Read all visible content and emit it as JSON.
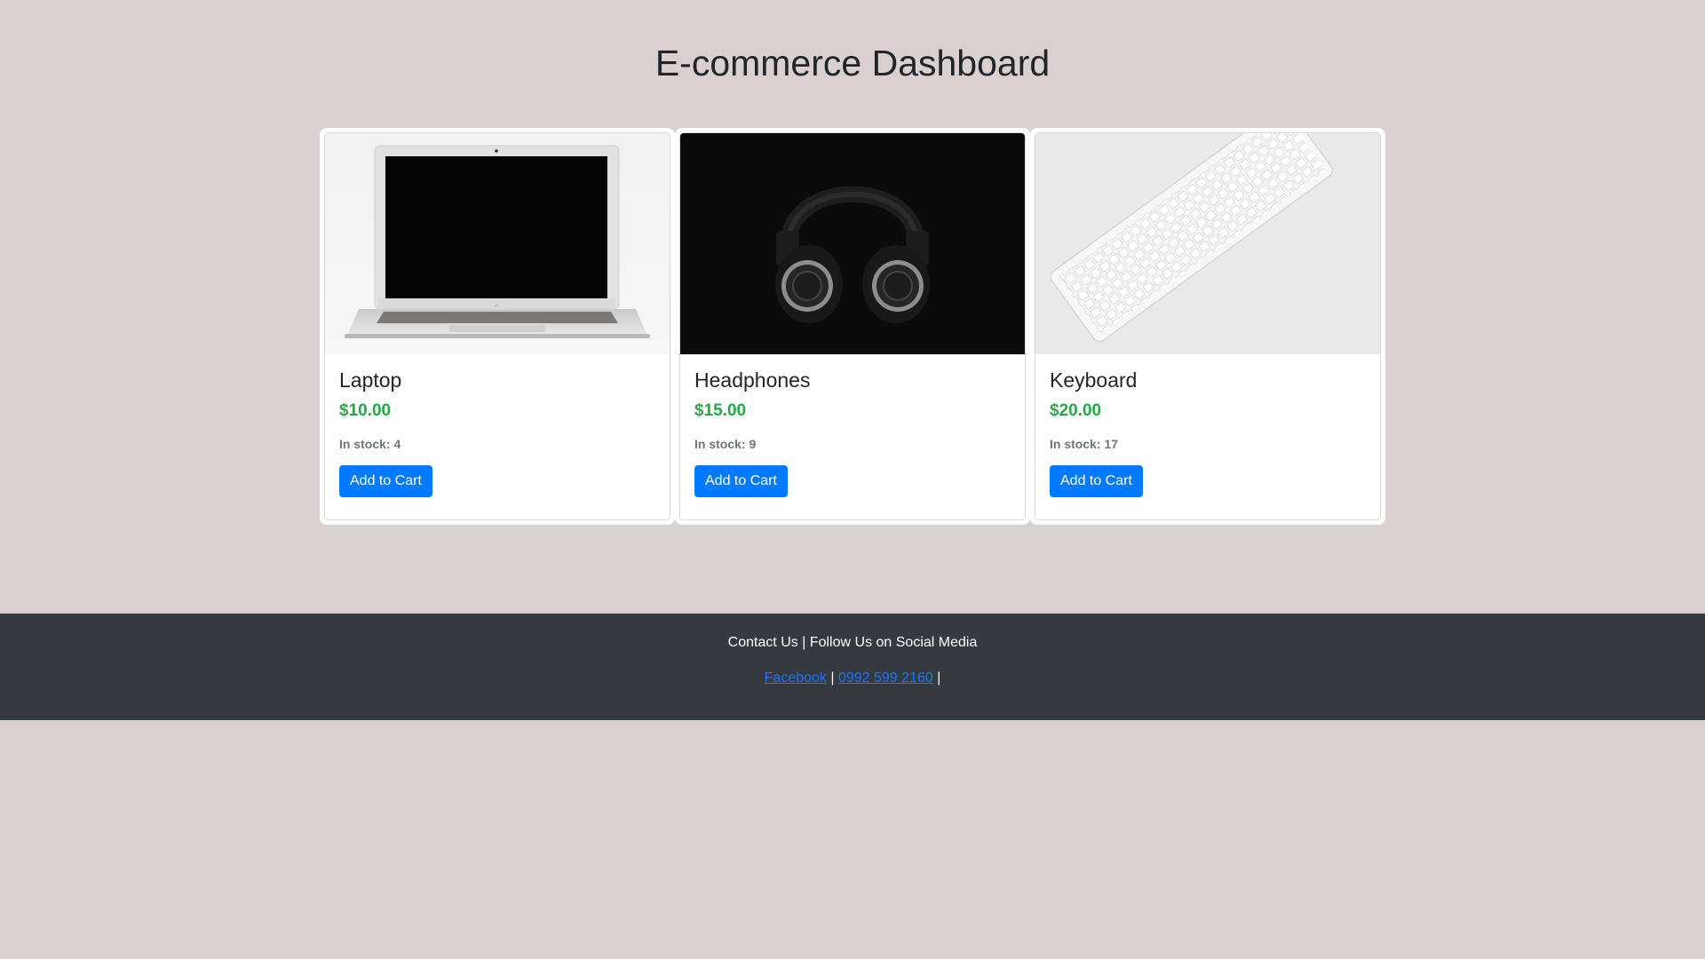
{
  "page": {
    "title": "E-commerce Dashboard"
  },
  "products": [
    {
      "name": "Laptop",
      "price": "$10.00",
      "stock": "In stock: 4",
      "button": "Add to Cart",
      "image": "laptop"
    },
    {
      "name": "Headphones",
      "price": "$15.00",
      "stock": "In stock: 9",
      "button": "Add to Cart",
      "image": "headphones"
    },
    {
      "name": "Keyboard",
      "price": "$20.00",
      "stock": "In stock: 17",
      "button": "Add to Cart",
      "image": "keyboard"
    }
  ],
  "footer": {
    "line1": "Contact Us | Follow Us on Social Media",
    "facebook": "Facebook",
    "phone": "0992 599 2160",
    "separator": "|"
  },
  "colors": {
    "background": "#dbd0d0",
    "price": "#28a745",
    "button": "#007bff",
    "footer": "#343a40",
    "link": "#1f73ff"
  }
}
